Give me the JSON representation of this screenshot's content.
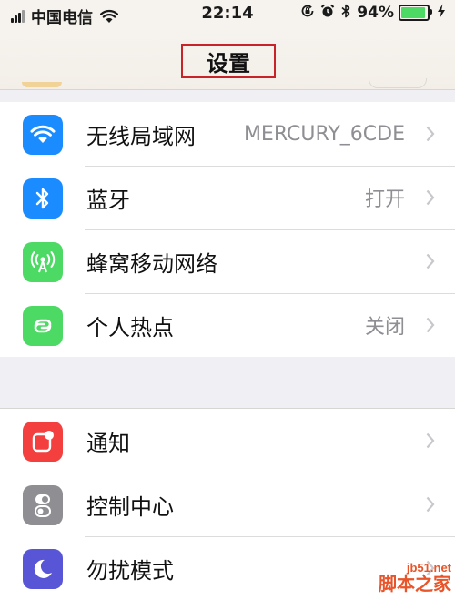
{
  "status_bar": {
    "carrier": "中国电信",
    "time": "22:14",
    "battery_percent": "94%",
    "battery_level": 0.94,
    "icons": [
      "signal-icon",
      "wifi-icon",
      "rotation-lock-icon",
      "alarm-icon",
      "bluetooth-icon",
      "battery-icon",
      "charging-icon"
    ]
  },
  "nav": {
    "title": "设置",
    "highlight_color": "#c9232a"
  },
  "groups": [
    {
      "rows": [
        {
          "label": "无线局域网",
          "value": "MERCURY_6CDE",
          "icon": "wifi-icon",
          "icon_color": "#1a8cff"
        },
        {
          "label": "蓝牙",
          "value": "打开",
          "icon": "bluetooth-icon",
          "icon_color": "#1a8cff"
        },
        {
          "label": "蜂窝移动网络",
          "value": "",
          "icon": "cellular-icon",
          "icon_color": "#4cd964"
        },
        {
          "label": "个人热点",
          "value": "关闭",
          "icon": "hotspot-icon",
          "icon_color": "#4cd964"
        }
      ]
    },
    {
      "rows": [
        {
          "label": "通知",
          "value": "",
          "icon": "notifications-icon",
          "icon_color": "#f43f3f"
        },
        {
          "label": "控制中心",
          "value": "",
          "icon": "control-center-icon",
          "icon_color": "#8e8e93"
        },
        {
          "label": "勿扰模式",
          "value": "",
          "icon": "do-not-disturb-icon",
          "icon_color": "#5856d6"
        }
      ]
    }
  ],
  "watermark": {
    "domain": "jb51.net",
    "name": "脚本之家",
    "color": "#e8552a"
  }
}
